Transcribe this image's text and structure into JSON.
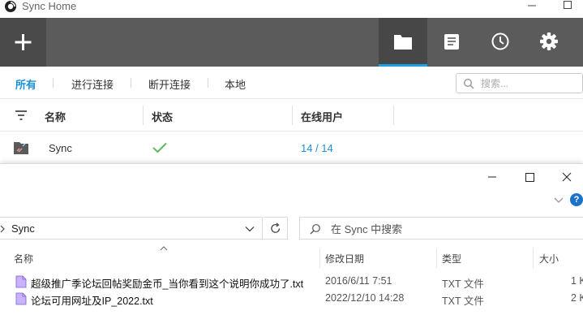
{
  "sync": {
    "title": "Sync Home",
    "filter_tabs": [
      "所有",
      "进行连接",
      "断开连接",
      "本地"
    ],
    "search_placeholder": "搜索...",
    "columns": {
      "name": "名称",
      "status": "状态",
      "online_users": "在线用户"
    },
    "row": {
      "name": "Sync",
      "online_users": "14 / 14"
    },
    "colors": {
      "accent": "#1a8fd6",
      "toolbar": "#5b5b5b",
      "ok": "#5cb85c"
    }
  },
  "explorer": {
    "address": "Sync",
    "search_placeholder": "在 Sync 中搜索",
    "columns": {
      "name": "名称",
      "modified": "修改日期",
      "type": "类型",
      "size": "大小"
    },
    "files": [
      {
        "name": "超级推广季论坛回帖奖励金币_当你看到这个说明你成功了.txt",
        "modified": "2016/6/11 7:51",
        "type": "TXT 文件",
        "size": "1 K"
      },
      {
        "name": "论坛可用网址及IP_2022.txt",
        "modified": "2022/12/10 14:28",
        "type": "TXT 文件",
        "size": "2 K"
      }
    ],
    "help_label": "?"
  }
}
